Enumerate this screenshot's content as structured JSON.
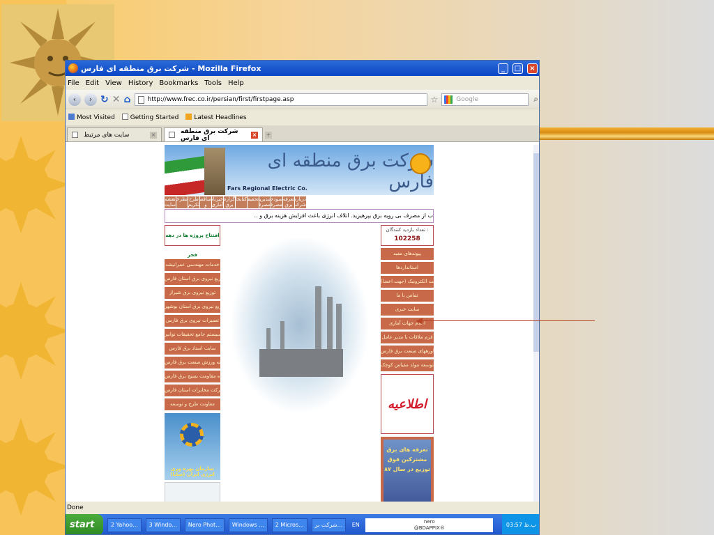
{
  "window": {
    "title": "شرکت برق منطقه ای فارس - Mozilla Firefox"
  },
  "menu": [
    "File",
    "Edit",
    "View",
    "History",
    "Bookmarks",
    "Tools",
    "Help"
  ],
  "nav": {
    "url": "http://www.frec.co.ir/persian/first/firstpage.asp",
    "search_placeholder": "Google"
  },
  "bookmarks": [
    "Most Visited",
    "Getting Started",
    "Latest Headlines"
  ],
  "tabs": [
    {
      "label": "سایت های مرتبط"
    },
    {
      "label": "شرکت برق منطقه ای فارس"
    }
  ],
  "status": "Done",
  "taskbar": {
    "start": "start",
    "items": [
      "2 Yahoo...",
      "3 Windo...",
      "Nero Phot...",
      "Windows ...",
      "2 Micros...",
      "شرکت بر..."
    ],
    "lang": "EN",
    "nero_line1": "nero",
    "nero_line2": "@BDAPPIX®",
    "clock": "03:57 ب.ظ"
  },
  "site": {
    "title": "شرکت برق منطقه ای فارس",
    "english": "Fars Regional Electric Co.",
    "topnav": [
      "درباره شرکت",
      "تعرفه برق",
      "سودحساب مصرف",
      "مدیریت مصرف",
      "تحقیقات",
      "کتابخانه",
      "گزارشات برق فارس",
      "خبرنامه آماری",
      "مناقصه و مزایده",
      "طرح تکریم",
      "نظرخواهی",
      "نقشه سایت"
    ],
    "marquee": "ب از مصرف بی رویه برق بپرهیزید. اتلاف انرژی باعث افزایش هزینه برق و ..",
    "left_header": "افتتاح پروژه ها در دهه فجر",
    "left_links": [
      "خدمات مهندسی عمرانیشه",
      "توزیع نیروی برق استان فارس",
      "توزیع نیروی برق شیراز",
      "توزیع نیروی برق استان بوشهر",
      "تعمیرات نیروی برق فارس",
      "سیستم جامع تحقیقات توانیر",
      "سایت اسناد برق فارس",
      "کمیته ورزش صنعت برق فارس",
      "پایگاه مقاومت بسیج برق فارس",
      "شرکت مخابرات استان فارس",
      "معاونت طرح و توسعه"
    ],
    "org_label": "سازمان بهره وری انرژی ایران (سابا)",
    "visitor_label": "تعداد بازدید کنندگان :",
    "visitor_count": "102258",
    "right_links": [
      "پیوندهای مفید",
      "استانداردها",
      "پست الکترونیک (جهت اعضا)",
      "تماس با ما",
      "سایت خبری",
      "اعلام جهات آماری",
      "فرم ملاقات با مدیر عامل",
      "مشاورههای صنعت برق فارس",
      "توسعه مولد مقیاس کوچک"
    ],
    "notice": "اطلاعیه",
    "ad_text": "تعرفه های برق مشترکین فوق توزیع در سال ۸۷"
  }
}
